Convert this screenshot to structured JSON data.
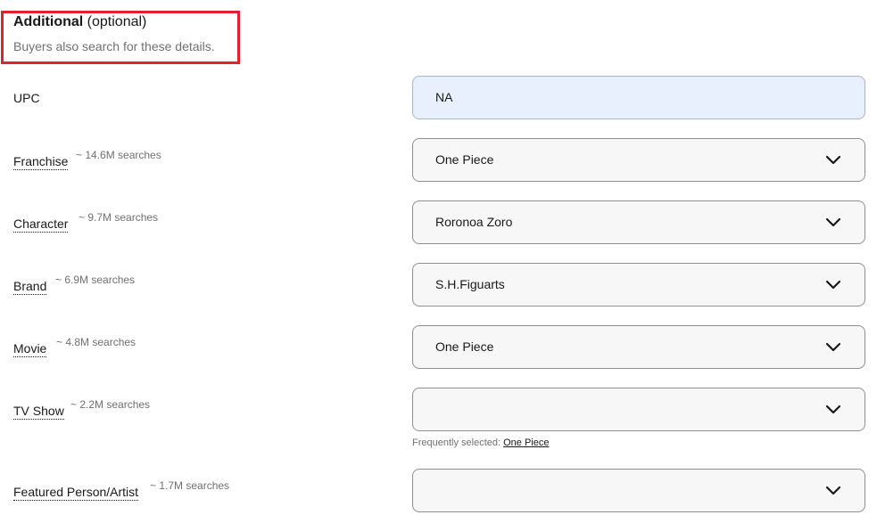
{
  "header": {
    "title_bold": "Additional",
    "title_light": "(optional)",
    "subtitle": "Buyers also search for these details.",
    "highlight_color": "#e3202f"
  },
  "fields": [
    {
      "label": "UPC",
      "searches": "",
      "value": "NA",
      "type": "text-input"
    },
    {
      "label": "Franchise",
      "searches": "~ 14.6M searches",
      "value": "One Piece",
      "type": "dropdown"
    },
    {
      "label": "Character",
      "searches": "~ 9.7M searches",
      "value": "Roronoa Zoro",
      "type": "dropdown"
    },
    {
      "label": "Brand",
      "searches": "~ 6.9M searches",
      "value": "S.H.Figuarts",
      "type": "dropdown"
    },
    {
      "label": "Movie",
      "searches": "~ 4.8M searches",
      "value": "One Piece",
      "type": "dropdown"
    },
    {
      "label": "TV Show",
      "searches": "~ 2.2M searches",
      "value": "",
      "type": "dropdown"
    },
    {
      "label": "Featured Person/Artist",
      "searches": "~ 1.7M searches",
      "value": "",
      "type": "dropdown"
    }
  ],
  "frequently_selected": {
    "prefix": "Frequently selected:",
    "option": "One Piece"
  },
  "icons": {
    "dropdown": "chevron-down-icon"
  }
}
